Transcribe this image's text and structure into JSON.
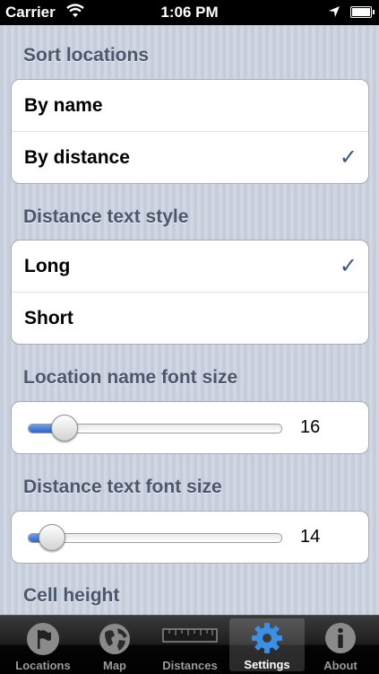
{
  "status_bar": {
    "carrier": "Carrier",
    "time": "1:06 PM"
  },
  "sections": {
    "sort": {
      "header": "Sort locations",
      "options": [
        {
          "label": "By name",
          "checked": false
        },
        {
          "label": "By distance",
          "checked": true
        }
      ]
    },
    "distance_style": {
      "header": "Distance text style",
      "options": [
        {
          "label": "Long",
          "checked": true
        },
        {
          "label": "Short",
          "checked": false
        }
      ]
    },
    "name_font_size": {
      "header": "Location name font size",
      "value": "16",
      "fraction": 0.14
    },
    "distance_font_size": {
      "header": "Distance text font size",
      "value": "14",
      "fraction": 0.09
    },
    "cell_height": {
      "header": "Cell height"
    }
  },
  "check_glyph": "✓",
  "tabs": [
    {
      "label": "Locations",
      "icon": "flag-icon",
      "active": false
    },
    {
      "label": "Map",
      "icon": "globe-icon",
      "active": false
    },
    {
      "label": "Distances",
      "icon": "ruler-icon",
      "active": false
    },
    {
      "label": "Settings",
      "icon": "gear-icon",
      "active": true
    },
    {
      "label": "About",
      "icon": "info-icon",
      "active": false
    }
  ],
  "colors": {
    "accent_check": "#385487",
    "slider_fill": "#2e64cf",
    "header_text": "#4c566c"
  }
}
